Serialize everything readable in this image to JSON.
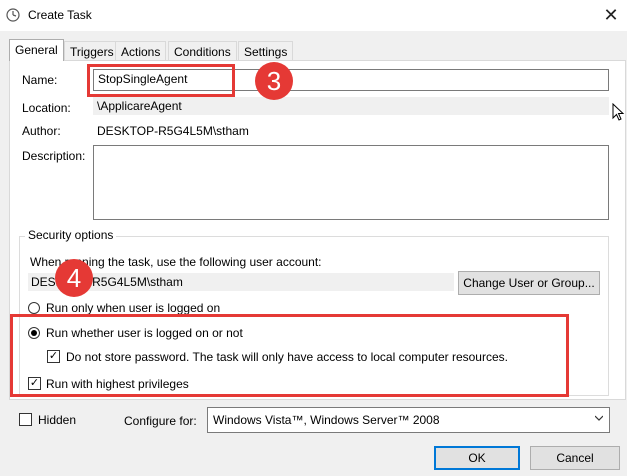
{
  "window": {
    "title": "Create Task",
    "close_glyph": "✕"
  },
  "tabs": [
    "General",
    "Triggers",
    "Actions",
    "Conditions",
    "Settings"
  ],
  "fields": {
    "name_label": "Name:",
    "name_value": "StopSingleAgent",
    "location_label": "Location:",
    "location_value": "\\ApplicareAgent",
    "author_label": "Author:",
    "author_value": "DESKTOP-R5G4L5M\\stham",
    "description_label": "Description:",
    "description_value": ""
  },
  "security": {
    "group_title": "Security options",
    "user_account_prompt": "When running the task, use the following user account:",
    "user_account_value": "DESKTOP-R5G4L5M\\stham",
    "change_user_button": "Change User or Group...",
    "radio_logged_on": "Run only when user is logged on",
    "radio_whether": "Run whether user is logged on or not",
    "check_no_password": "Do not store password.  The task will only have access to local computer resources.",
    "check_highest": "Run with highest privileges"
  },
  "bottom": {
    "hidden_label": "Hidden",
    "configure_label": "Configure for:",
    "configure_value": "Windows Vista™, Windows Server™ 2008"
  },
  "buttons": {
    "ok": "OK",
    "cancel": "Cancel"
  },
  "annotations": {
    "step3": "3",
    "step4": "4"
  },
  "colors": {
    "callout": "#e53935",
    "accent": "#0078d7"
  }
}
